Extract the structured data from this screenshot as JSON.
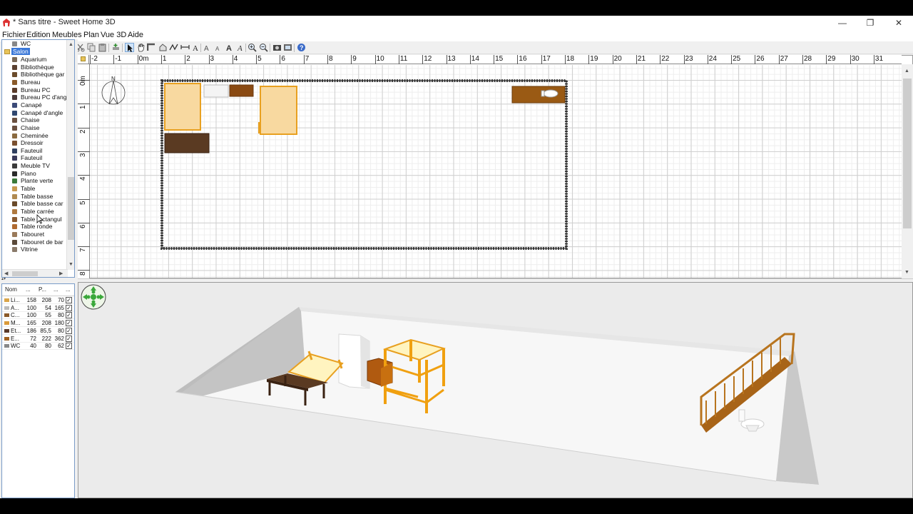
{
  "window": {
    "title": "* Sans titre - Sweet Home 3D",
    "minimize": "—",
    "maximize": "❐",
    "close": "✕"
  },
  "menu": [
    "Fichier",
    "Edition",
    "Meubles",
    "Plan",
    "Vue 3D",
    "Aide"
  ],
  "toolbar": {
    "buttons": [
      "new-icon",
      "open-icon",
      "save-icon",
      "cut-icon",
      "undo-icon",
      "redo-icon",
      "cut-icon",
      "copy-icon",
      "paste-icon",
      "add-furniture-icon",
      "select-icon",
      "pan-icon",
      "create-walls-icon",
      "create-rooms-icon",
      "create-polylines-icon",
      "create-dimensions-icon",
      "add-text-icon",
      "increase-text-icon",
      "decrease-text-icon",
      "bold-icon",
      "italic-icon",
      "zoom-in-icon",
      "zoom-out-icon",
      "photo-icon",
      "video-icon",
      "help-icon"
    ]
  },
  "catalog": {
    "above": "WC",
    "category": "Salon",
    "items": [
      "Aquarium",
      "Bibliothèque",
      "Bibliothèque gar",
      "Bureau",
      "Bureau PC",
      "Bureau PC d'ang",
      "Canapé",
      "Canapé d'angle",
      "Chaise",
      "Chaise",
      "Cheminée",
      "Dressoir",
      "Fauteuil",
      "Fauteuil",
      "Meuble TV",
      "Piano",
      "Plante verte",
      "Table",
      "Table basse",
      "Table basse car",
      "Table carrée",
      "Table rectangul",
      "Table ronde",
      "Tabouret",
      "Tabouret de bar",
      "Vitrine"
    ],
    "item_colors": [
      "#7a6a58",
      "#5a4030",
      "#6b4b2b",
      "#8a5a2a",
      "#5a3b2a",
      "#4a3a3a",
      "#3b4a78",
      "#304870",
      "#6a5040",
      "#6a5040",
      "#8a6a40",
      "#7a5030",
      "#304060",
      "#3a3a5a",
      "#3a3a3a",
      "#2a2a2a",
      "#3a7a3a",
      "#c89a50",
      "#b08a50",
      "#6a4a2a",
      "#b07a40",
      "#8a5a30",
      "#b06a30",
      "#9a7a5a",
      "#5a4a3a",
      "#8a7a6a"
    ]
  },
  "furniture_table": {
    "headers": [
      "Nom",
      "...",
      "P...",
      "...",
      "..."
    ],
    "rows": [
      {
        "name": "Li...",
        "w": "158",
        "d": "208",
        "h": "70",
        "visible": true,
        "color": "#d9a54a"
      },
      {
        "name": "A...",
        "w": "100",
        "d": "54",
        "h": "165",
        "visible": true,
        "color": "#bbbbbb"
      },
      {
        "name": "C...",
        "w": "100",
        "d": "55",
        "h": "80",
        "visible": true,
        "color": "#8a5a2a"
      },
      {
        "name": "M...",
        "w": "165",
        "d": "208",
        "h": "180",
        "visible": true,
        "color": "#d99a3a"
      },
      {
        "name": "Et...",
        "w": "186",
        "d": "85,5",
        "h": "80",
        "visible": true,
        "color": "#5a3a2a"
      },
      {
        "name": "E...",
        "w": "72",
        "d": "222",
        "h": "362",
        "visible": true,
        "color": "#a06020"
      },
      {
        "name": "WC",
        "w": "40",
        "d": "80",
        "h": "62",
        "visible": true,
        "color": "#888888"
      }
    ]
  },
  "plan": {
    "ruler_x": [
      "-2",
      "-1",
      "0m",
      "1",
      "2",
      "3",
      "4",
      "5",
      "6",
      "7",
      "8",
      "9",
      "10",
      "11",
      "12",
      "13",
      "14",
      "15",
      "16",
      "17",
      "18",
      "19",
      "20",
      "21",
      "22",
      "23",
      "24",
      "25",
      "26",
      "27",
      "28",
      "29",
      "30",
      "31"
    ],
    "ruler_y": [
      "0m",
      "1",
      "2",
      "3",
      "4",
      "5",
      "6",
      "7",
      "8"
    ],
    "compass_label": "N"
  },
  "colors": {
    "selection": "#3b78d8",
    "bed": "#f8d9a0",
    "bed_border": "#e8a020",
    "dark_wood": "#5a3a22",
    "stair": "#a86418"
  }
}
